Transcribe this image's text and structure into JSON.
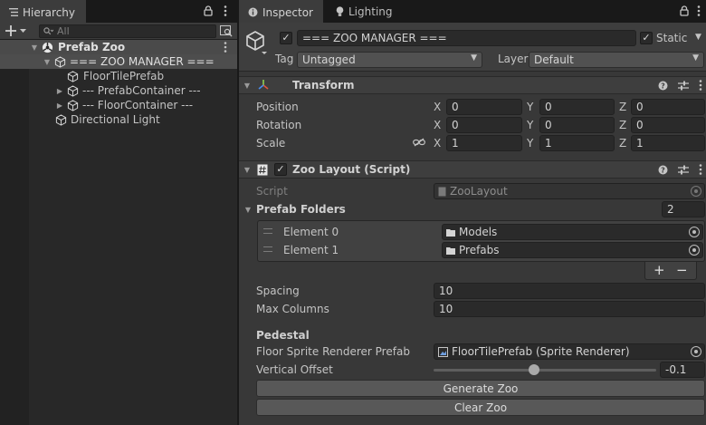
{
  "hierarchy": {
    "tab_label": "Hierarchy",
    "search_placeholder": "All",
    "rows": [
      {
        "label": "Prefab Zoo",
        "kind": "scene"
      },
      {
        "label": "=== ZOO MANAGER ===",
        "kind": "selected"
      },
      {
        "label": "FloorTilePrefab",
        "kind": "child"
      },
      {
        "label": "--- PrefabContainer ---",
        "kind": "collapsed"
      },
      {
        "label": "--- FloorContainer ---",
        "kind": "collapsed"
      },
      {
        "label": "Directional Light",
        "kind": "root"
      }
    ]
  },
  "inspector": {
    "tabs": {
      "inspector": "Inspector",
      "lighting": "Lighting"
    },
    "object_name": "=== ZOO MANAGER ===",
    "static_label": "Static",
    "tag_label": "Tag",
    "tag_value": "Untagged",
    "layer_label": "Layer",
    "layer_value": "Default",
    "transform": {
      "title": "Transform",
      "rows": [
        {
          "label": "Position",
          "x": "0",
          "y": "0",
          "z": "0"
        },
        {
          "label": "Rotation",
          "x": "0",
          "y": "0",
          "z": "0"
        },
        {
          "label": "Scale",
          "x": "1",
          "y": "1",
          "z": "1"
        }
      ],
      "axis_x": "X",
      "axis_y": "Y",
      "axis_z": "Z"
    },
    "zoo_layout": {
      "title": "Zoo Layout (Script)",
      "script_label": "Script",
      "script_value": "ZooLayout",
      "prefab_folders_label": "Prefab Folders",
      "prefab_folders_count": "2",
      "elements": [
        {
          "label": "Element 0",
          "value": "Models"
        },
        {
          "label": "Element 1",
          "value": "Prefabs"
        }
      ],
      "add_label": "+",
      "remove_label": "−",
      "spacing_label": "Spacing",
      "spacing_value": "10",
      "max_columns_label": "Max Columns",
      "max_columns_value": "10",
      "pedestal_header": "Pedestal",
      "floor_sprite_label": "Floor Sprite Renderer Prefab",
      "floor_sprite_value": "FloorTilePrefab (Sprite Renderer)",
      "vertical_offset_label": "Vertical Offset",
      "vertical_offset_value": "-0.1",
      "vertical_offset_fraction": 0.45,
      "generate_button": "Generate Zoo",
      "clear_button": "Clear Zoo"
    }
  },
  "colors": {
    "panel": "#383838",
    "header": "#3e3e3e",
    "field": "#2a2a2a",
    "button": "#585858",
    "text": "#c4c4c4"
  }
}
